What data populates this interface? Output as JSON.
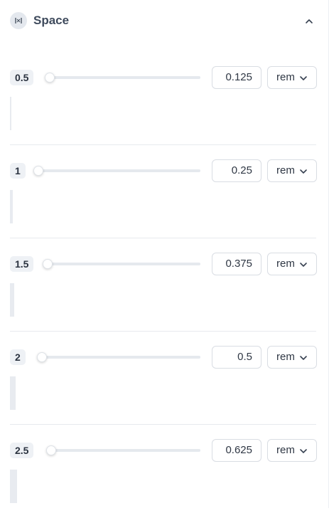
{
  "panel": {
    "title": "Space",
    "icon": "space-icon",
    "collapse_icon": "chevron-up-icon"
  },
  "colors": {
    "preview_bar": "#e8ebf0",
    "badge_bg": "#eef1f5",
    "track": "#e5e9ee",
    "title": "#3e4a5c"
  },
  "rows": [
    {
      "step": "0.5",
      "value": "0.125",
      "unit": "rem",
      "slider_fraction": 0.0
    },
    {
      "step": "1",
      "value": "0.25",
      "unit": "rem",
      "slider_fraction": 0.0
    },
    {
      "step": "1.5",
      "value": "0.375",
      "unit": "rem",
      "slider_fraction": 0.0
    },
    {
      "step": "2",
      "value": "0.5",
      "unit": "rem",
      "slider_fraction": 0.0
    },
    {
      "step": "2.5",
      "value": "0.625",
      "unit": "rem",
      "slider_fraction": 0.0
    }
  ]
}
